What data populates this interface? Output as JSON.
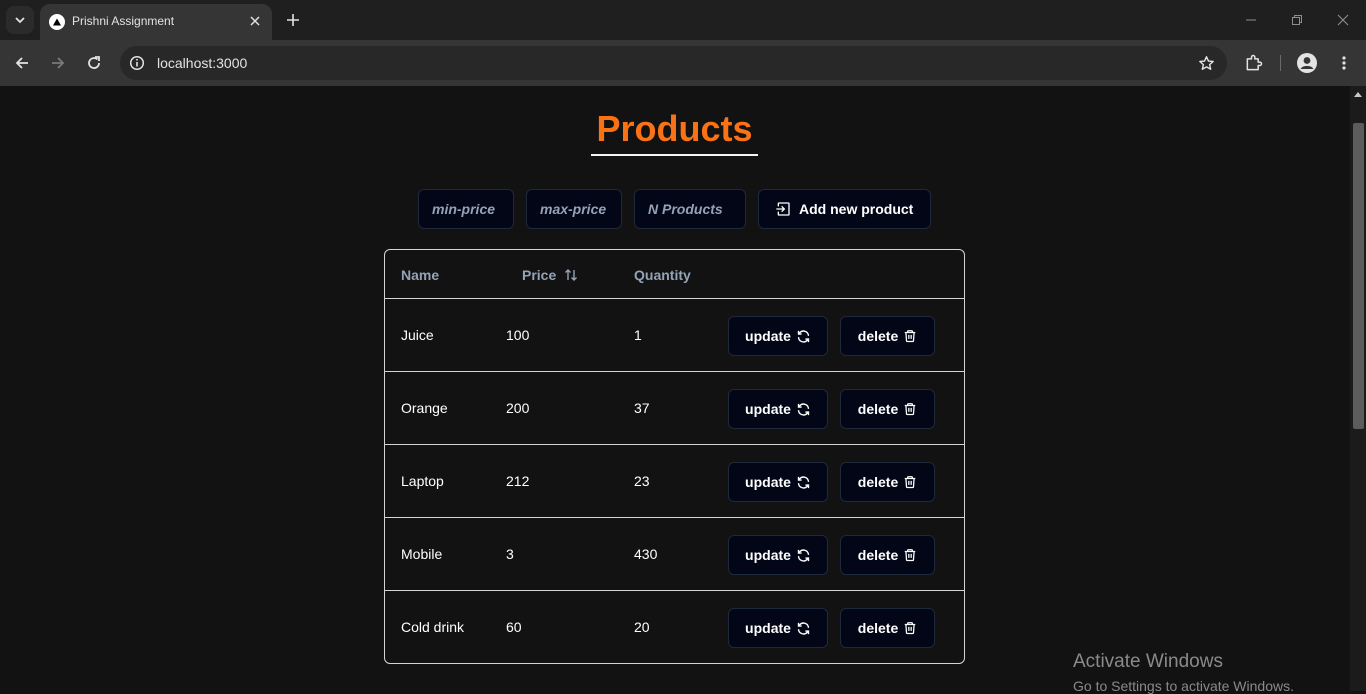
{
  "browser": {
    "tab_title": "Prishni Assignment",
    "url": "localhost:3000"
  },
  "page": {
    "title": "Products",
    "accent_color": "#f97316"
  },
  "controls": {
    "min_price_placeholder": "min-price",
    "max_price_placeholder": "max-price",
    "n_products_placeholder": "N Products",
    "add_button_label": "Add new product"
  },
  "table": {
    "headers": {
      "name": "Name",
      "price": "Price",
      "quantity": "Quantity"
    },
    "update_label": "update",
    "delete_label": "delete",
    "rows": [
      {
        "name": "Juice",
        "price": "100",
        "quantity": "1"
      },
      {
        "name": "Orange",
        "price": "200",
        "quantity": "37"
      },
      {
        "name": "Laptop",
        "price": "212",
        "quantity": "23"
      },
      {
        "name": "Mobile",
        "price": "3",
        "quantity": "430"
      },
      {
        "name": "Cold drink",
        "price": "60",
        "quantity": "20"
      }
    ]
  },
  "watermark": {
    "line1": "Activate Windows",
    "line2": "Go to Settings to activate Windows."
  },
  "icons": [
    "tab-search-icon",
    "vercel-logo-icon",
    "close-icon",
    "plus-icon",
    "minimize-icon",
    "restore-icon",
    "back-icon",
    "forward-icon",
    "reload-icon",
    "info-icon",
    "star-icon",
    "extensions-icon",
    "profile-icon",
    "more-icon",
    "sort-icon",
    "login-icon",
    "refresh-icon",
    "trash-icon"
  ]
}
